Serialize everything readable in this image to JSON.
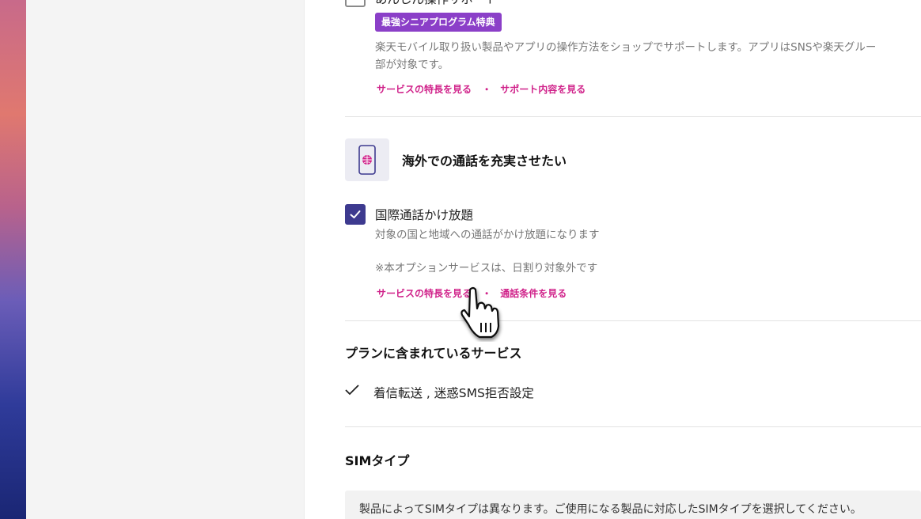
{
  "prev_option": {
    "label": "あんしん操作サポート",
    "badge": "最強シニアプログラム特典",
    "description_line1": "楽天モバイル取り扱い製品やアプリの操作方法をショップでサポートします。アプリはSNSや楽天グルー",
    "description_line2": "部が対象です。",
    "link_features": "サービスの特長を見る",
    "link_separator": "・",
    "link_support": "サポート内容を見る"
  },
  "section_overseas": {
    "heading": "海外での通話を充実させたい",
    "icon": "phone-globe-icon"
  },
  "intl_call_option": {
    "label": "国際通話かけ放題",
    "checked": true,
    "description": "対象の国と地域への通話がかけ放題になります",
    "note": "※本オプションサービスは、日割り対象外です",
    "link_features": "サービスの特長を見る",
    "link_separator": "・",
    "link_conditions": "通話条件を見る"
  },
  "included_services": {
    "heading": "プランに含まれているサービス",
    "item": "着信転送 , 迷惑SMS拒否設定"
  },
  "sim_type": {
    "heading": "SIMタイプ",
    "info": "製品によってSIMタイプは異なります。ご使用になる製品に対応したSIMタイプを選択してください。"
  },
  "colors": {
    "accent_purple": "#3d3a8f",
    "badge_purple": "#8b3fc8",
    "link_pink": "#d0228a"
  }
}
